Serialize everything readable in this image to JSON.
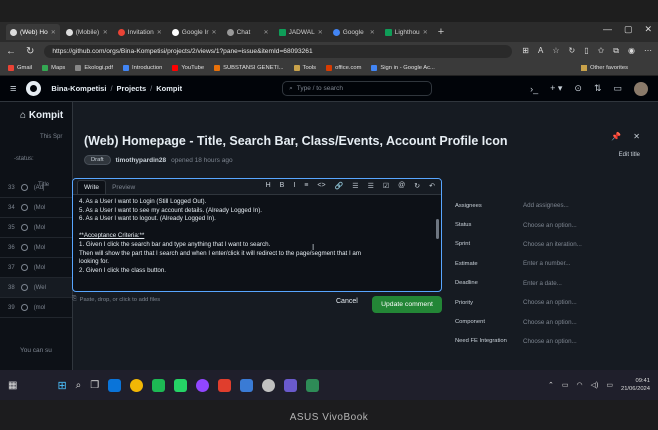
{
  "browser": {
    "tabs": [
      {
        "label": "(Web) Ho",
        "active": true
      },
      {
        "label": "(Mobile) ",
        "active": false
      },
      {
        "label": "Invitation",
        "active": false
      },
      {
        "label": "Google Ir",
        "active": false
      },
      {
        "label": "Chat",
        "active": false
      },
      {
        "label": "JADWAL",
        "active": false
      },
      {
        "label": "Google",
        "active": false
      },
      {
        "label": "Lighthou",
        "active": false
      }
    ],
    "url": "https://github.com/orgs/Bina-Kompetisi/projects/2/views/1?pane=issue&itemId=68093261",
    "bookmarks": [
      "Gmail",
      "Maps",
      "Ekologi.pdf",
      "Introduction",
      "YouTube",
      "SUBSTANSI GENETI...",
      "Tools",
      "office.com",
      "Sign in - Google Ac..."
    ],
    "other_bookmarks": "Other favorites"
  },
  "github": {
    "breadcrumbs": [
      "Bina-Kompetisi",
      "Projects",
      "Kompit"
    ],
    "search_placeholder": "Type / to search"
  },
  "project": {
    "title": "Kompit",
    "subtitle": "This Spr",
    "filter": "-status:",
    "column_title": "Title",
    "rows": [
      {
        "num": "33",
        "label": "(Adj"
      },
      {
        "num": "34",
        "label": "(Mol"
      },
      {
        "num": "35",
        "label": "(Mol"
      },
      {
        "num": "36",
        "label": "(Mol"
      },
      {
        "num": "37",
        "label": "(Mol"
      },
      {
        "num": "38",
        "label": "(Wel"
      },
      {
        "num": "39",
        "label": "(mol"
      }
    ],
    "footer_hint": "You can su"
  },
  "issue": {
    "title": "(Web) Homepage - Title, Search Bar, Class/Events, Account Profile Icon",
    "badge": "Draft",
    "author": "timothypardin28",
    "opened": "opened 18 hours ago",
    "edit_title": "Edit title"
  },
  "editor": {
    "tab_write": "Write",
    "tab_preview": "Preview",
    "toolbar": [
      "H",
      "B",
      "I",
      "≡",
      "<>",
      "🔗",
      "☰",
      "☰",
      "☑",
      "@",
      "↻",
      "↶"
    ],
    "lines": [
      "4. As a User I want to Login (Still Logged Out).",
      "5. As a User I want to see my account details. (Already Logged In).",
      "6. As a User I want to logout. (Already Logged In).",
      "",
      "**Acceptance Criteria:**",
      "1. Given I click the search bar and type anything that I want to search.",
      "Then will show the part that I search and when I enter/click it will redirect to the page/segment that I am",
      "looking for.",
      "2. Given I click the class button."
    ],
    "attach_hint": "Paste, drop, or click to add files",
    "cancel": "Cancel",
    "update": "Update comment"
  },
  "fields": [
    {
      "label": "Assignees",
      "value": "Add assignees..."
    },
    {
      "label": "Status",
      "value": "Choose an option..."
    },
    {
      "label": "Sprint",
      "value": "Choose an iteration..."
    },
    {
      "label": "Estimate",
      "value": "Enter a number..."
    },
    {
      "label": "Deadline",
      "value": "Enter a date..."
    },
    {
      "label": "Priority",
      "value": "Choose an option..."
    },
    {
      "label": "Component",
      "value": "Choose an option..."
    },
    {
      "label": "Need FE Integration",
      "value": "Choose an option..."
    }
  ],
  "taskbar": {
    "time": "09:41",
    "date": "21/06/2024",
    "app_colors": [
      "#0a74d9",
      "#f2b705",
      "#1db954",
      "#25d366",
      "#9146ff",
      "#e03e2d",
      "#3a7bd5",
      "#c0c0c0",
      "#6a5acd",
      "#2e8b57"
    ]
  },
  "device": {
    "brand": "ASUS VivoBook"
  },
  "colors": {
    "accent": "#58a6ff",
    "primary_button": "#238636"
  }
}
